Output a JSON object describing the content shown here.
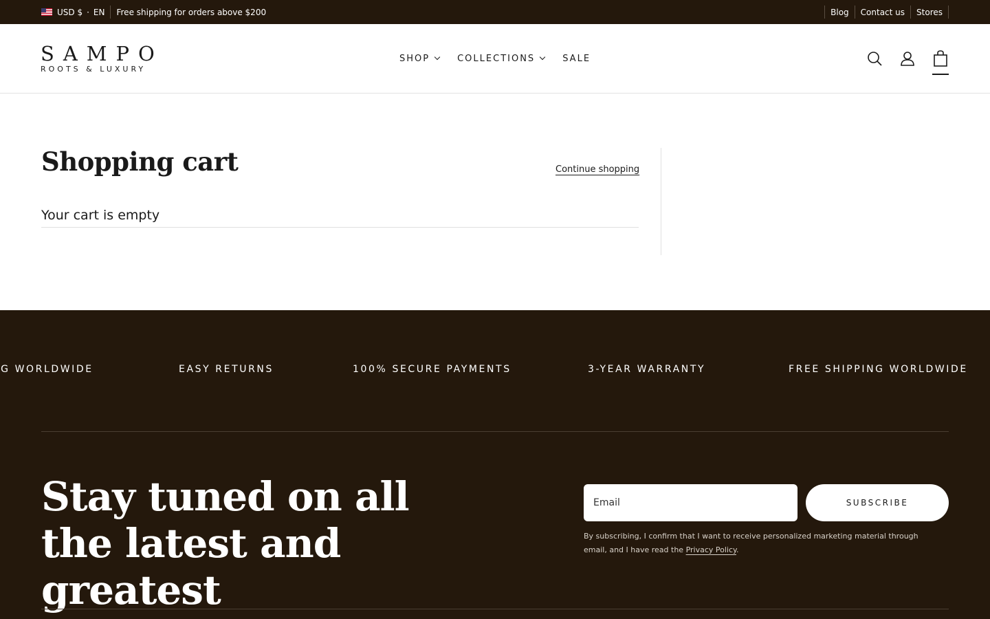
{
  "topbar": {
    "currency": "USD $",
    "separator": "·",
    "language": "EN",
    "announcement": "Free shipping for orders above $200",
    "links": [
      "Blog",
      "Contact us",
      "Stores"
    ]
  },
  "header": {
    "logo_main": "SAMPO",
    "logo_sub": "ROOTS & LUXURY",
    "nav": [
      {
        "label": "SHOP",
        "dropdown": true
      },
      {
        "label": "COLLECTIONS",
        "dropdown": true
      },
      {
        "label": "SALE",
        "dropdown": false
      }
    ],
    "icons": [
      "search-icon",
      "account-icon",
      "cart-icon"
    ]
  },
  "cart": {
    "title": "Shopping cart",
    "continue_label": "Continue shopping",
    "empty_message": "Your cart is empty"
  },
  "footer": {
    "marquee": [
      "NG WORLDWIDE",
      "EASY RETURNS",
      "100% SECURE PAYMENTS",
      "3-YEAR WARRANTY",
      "FREE SHIPPING WORLDWIDE"
    ],
    "tagline": "Stay tuned on all the latest and greatest",
    "email_placeholder": "Email",
    "subscribe_label": "SUBSCRIBE",
    "consent_text": "By subscribing, I confirm that I want to receive personalized marketing material through email, and I have read the ",
    "privacy_label": "Privacy Policy",
    "consent_end": "."
  },
  "colors": {
    "dark_brown": "#24180c",
    "white": "#ffffff",
    "text": "#1a1a1a"
  }
}
